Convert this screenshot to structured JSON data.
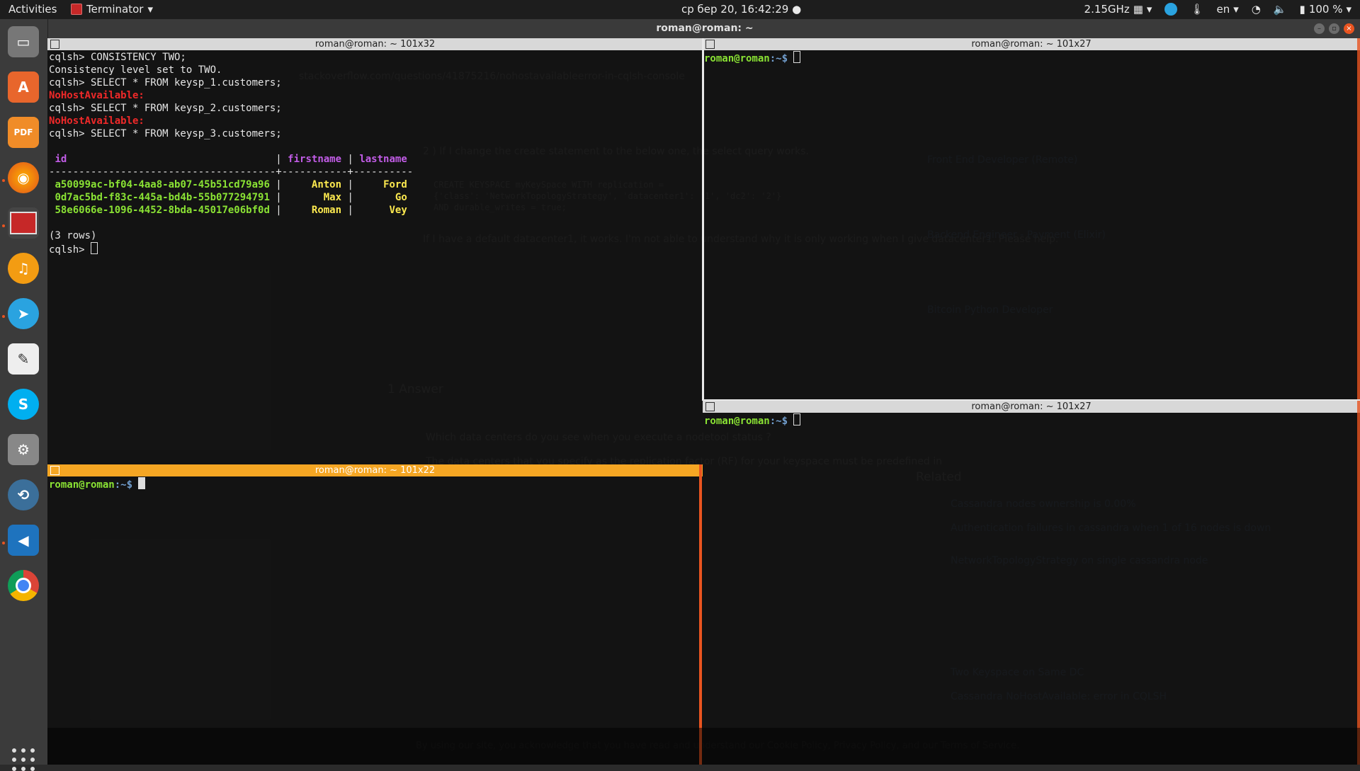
{
  "topbar": {
    "activities": "Activities",
    "app_name": "Terminator",
    "clock": "ср бер 20, 16:42:29 ●",
    "cpu": "2.15GHz",
    "lang": "en",
    "battery": "100 %"
  },
  "window": {
    "title": "roman@roman: ~"
  },
  "panes": {
    "top_left": {
      "title": "roman@roman: ~ 101x32",
      "lines": {
        "l1": "cqlsh> CONSISTENCY TWO;",
        "l2": "Consistency level set to TWO.",
        "l3": "cqlsh> SELECT * FROM keysp_1.customers;",
        "l4": "NoHostAvailable:",
        "l5": "cqlsh> SELECT * FROM keysp_2.customers;",
        "l6": "NoHostAvailable:",
        "l7": "cqlsh> SELECT * FROM keysp_3.customers;"
      },
      "table": {
        "col_id": "id",
        "col_firstname": "firstname",
        "col_lastname": "lastname",
        "sep": "--------------------------------------+-----------+----------",
        "rows": [
          {
            "id": "a50099ac-bf04-4aa8-ab07-45b51cd79a96",
            "first": "Anton",
            "last": "Ford"
          },
          {
            "id": "0d7ac5bd-f83c-445a-bd4b-55b077294791",
            "first": "Max",
            "last": "Go"
          },
          {
            "id": "58e6066e-1096-4452-8bda-45017e06bf0d",
            "first": "Roman",
            "last": "Vey"
          }
        ],
        "count": "(3 rows)",
        "prompt": "cqlsh>"
      }
    },
    "bottom_left": {
      "title": "roman@roman: ~ 101x22",
      "prompt_user": "roman@roman",
      "prompt_path": ":~$"
    },
    "top_right": {
      "title": "roman@roman: ~ 101x27",
      "prompt_user": "roman@roman",
      "prompt_path": ":~$"
    },
    "bottom_right": {
      "title": "roman@roman: ~ 101x27",
      "prompt_user": "roman@roman",
      "prompt_path": ":~$"
    }
  },
  "background_page": {
    "url": "stackoverflow.com/questions/41875216/nohostavailableerror-in-cqlsh-console",
    "question_text": "2 ) If I change the create statement to the below one, the select query works.",
    "code_line1": "CREATE KEYSPACE myKeySpace WITH replication =",
    "code_line2": "{'class': 'NetworkTopologyStrategy', 'datacenter1': '1', 'dc2': '2'}",
    "code_line3": "AND durable_writes = true;",
    "para": "If I have a default datacenter1, it works. I'm not able to understand why it is only working when I give datacenter1. Please help.",
    "answers_heading": "1 Answer",
    "answer_q": "Which data centers do you see when you execute a nodetool status ?",
    "answer_text": "The data centers that you specify as the replication factor (RF) for your keyspace must be predefined in",
    "related": "Related",
    "related_items": [
      "Cassandra nodes ownership is 0.00%",
      "Authentication failures in cassandra when 1 of 16 nodes is down",
      "NetworkTopologyStrategy on single cassandra node",
      "Two Keyspace on Same DC",
      "Cassandra NoHostAvailable: error in CQLSH"
    ],
    "jobs": [
      "Front End Developer (Remote)",
      "Backend Engineer - Payment (Elixir)",
      "Bitcoin Python Developer"
    ],
    "cookie": "By using our site, you acknowledge that you have read and understand our Cookie Policy, Privacy Policy, and our Terms of Service."
  }
}
